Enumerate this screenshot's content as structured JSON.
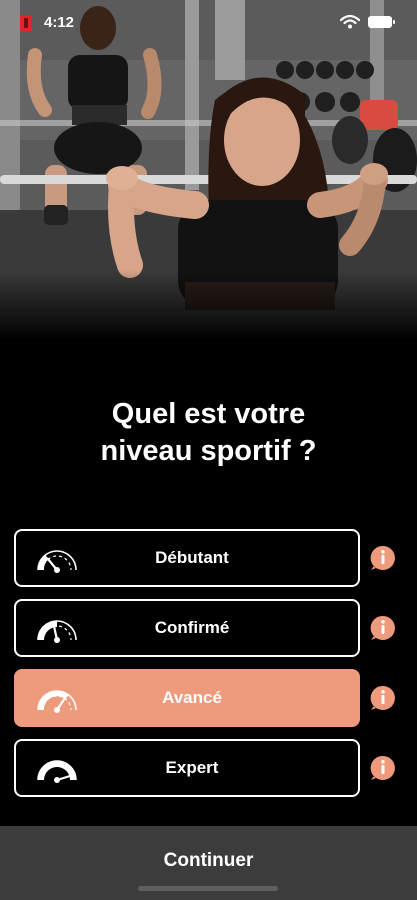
{
  "status_bar": {
    "time": "4:12"
  },
  "question": {
    "line1": "Quel est votre",
    "line2": "niveau sportif ?"
  },
  "options": [
    {
      "label": "Débutant",
      "level": 1,
      "selected": false
    },
    {
      "label": "Confirmé",
      "level": 2,
      "selected": false
    },
    {
      "label": "Avancé",
      "level": 3,
      "selected": true
    },
    {
      "label": "Expert",
      "level": 4,
      "selected": false
    }
  ],
  "continue_button": {
    "label": "Continuer"
  },
  "colors": {
    "accent": "#ee9a7c",
    "info_badge": "#ee9a7c",
    "background": "#000000",
    "continue_bg": "#3c3c3c"
  },
  "icons": {
    "level": "speedometer-gauge-icon",
    "info": "info-speech-bubble-icon"
  }
}
